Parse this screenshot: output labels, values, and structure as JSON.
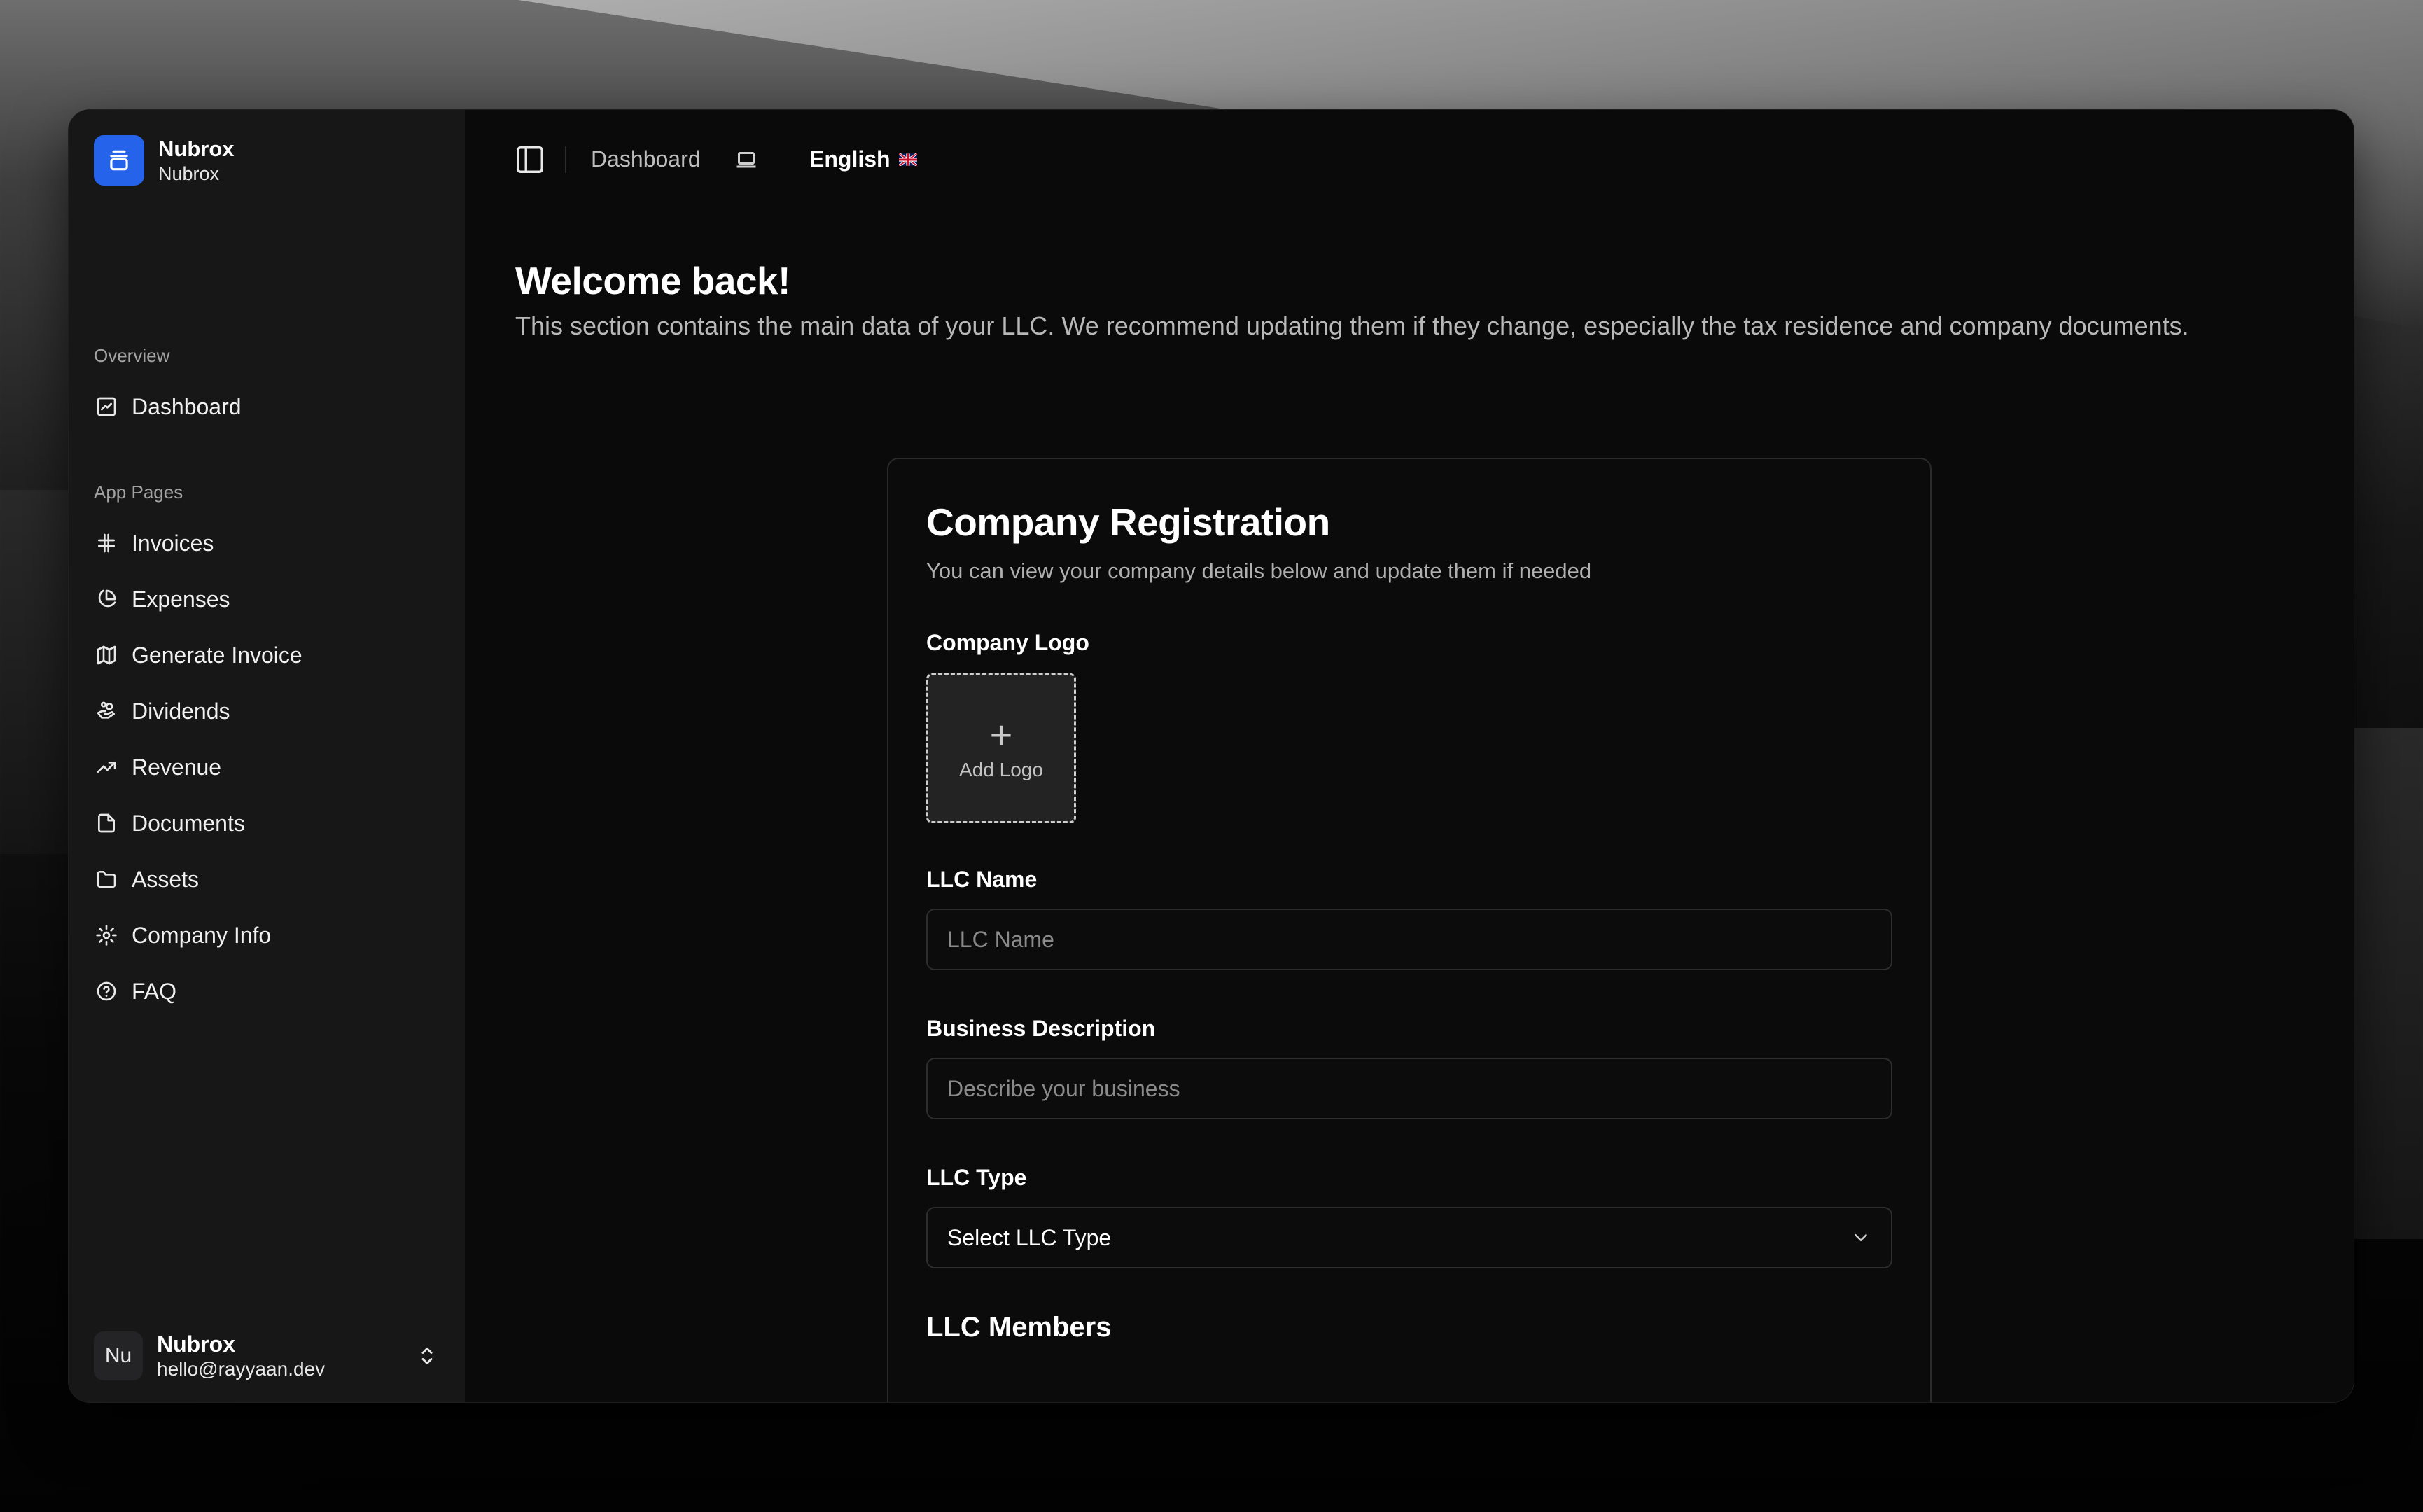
{
  "brand": {
    "name": "Nubrox",
    "subtitle": "Nubrox",
    "accent": "#2563eb"
  },
  "sidebar": {
    "overview_label": "Overview",
    "overview_items": [
      {
        "label": "Dashboard",
        "icon": "dashboard-icon"
      }
    ],
    "app_pages_label": "App Pages",
    "app_pages_items": [
      {
        "label": "Invoices",
        "icon": "hash-icon"
      },
      {
        "label": "Expenses",
        "icon": "pie-chart-icon"
      },
      {
        "label": "Generate Invoice",
        "icon": "map-icon"
      },
      {
        "label": "Dividends",
        "icon": "hand-coins-icon"
      },
      {
        "label": "Revenue",
        "icon": "trending-up-icon"
      },
      {
        "label": "Documents",
        "icon": "file-icon"
      },
      {
        "label": "Assets",
        "icon": "folder-icon"
      },
      {
        "label": "Company Info",
        "icon": "gear-icon"
      },
      {
        "label": "FAQ",
        "icon": "help-circle-icon"
      }
    ]
  },
  "user": {
    "initials": "Nu",
    "name": "Nubrox",
    "email": "hello@rayyaan.dev"
  },
  "topbar": {
    "breadcrumb": "Dashboard",
    "language": "English"
  },
  "page": {
    "title": "Welcome back!",
    "subtitle": "This section contains the main data of your LLC. We recommend updating them if they change, especially the tax residence and company documents."
  },
  "form": {
    "title": "Company Registration",
    "subtitle": "You can view your company details below and update them if needed",
    "logo_label": "Company Logo",
    "logo_button": "Add Logo",
    "llc_name_label": "LLC Name",
    "llc_name_placeholder": "LLC Name",
    "description_label": "Business Description",
    "description_placeholder": "Describe your business",
    "type_label": "LLC Type",
    "type_value": "Select LLC Type",
    "members_title": "LLC Members"
  }
}
